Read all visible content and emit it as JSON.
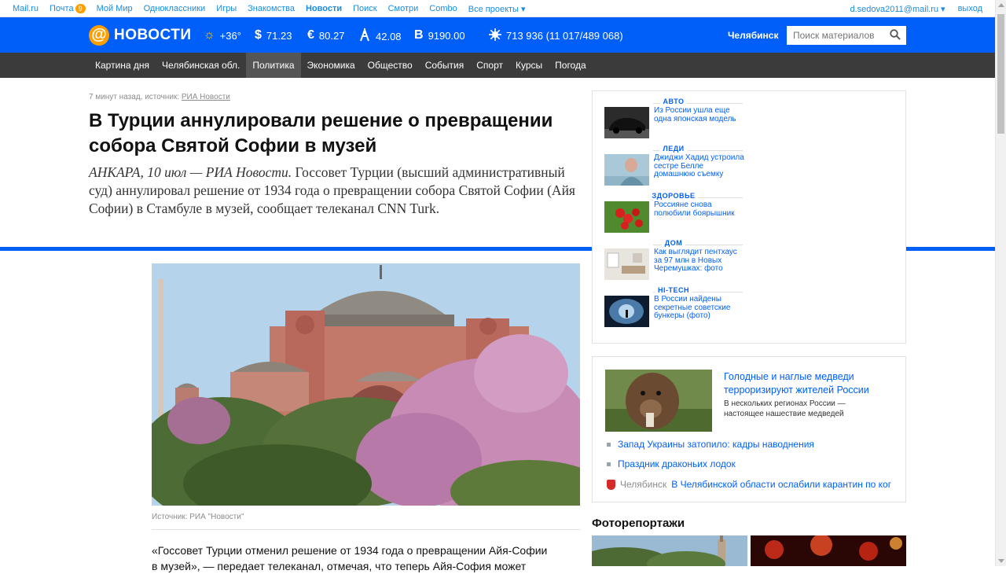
{
  "portal": {
    "links": [
      "Mail.ru",
      "Почта",
      "Мой Мир",
      "Одноклассники",
      "Игры",
      "Знакомства",
      "Новости",
      "Поиск",
      "Смотри",
      "Combo",
      "Все проекты"
    ],
    "mail_count": "9",
    "account": "d.sedova2011@mail.ru",
    "logout": "выход"
  },
  "header": {
    "logo_text": "НОВОСТИ",
    "weather": "+36°",
    "usd": "71.23",
    "eur": "80.27",
    "oil": "42.08",
    "btc": "9190.00",
    "virus": "713 936 (11 017/489 068)",
    "city": "Челябинск",
    "search_placeholder": "Поиск материалов"
  },
  "nav": {
    "items": [
      "Картина дня",
      "Челябинская обл.",
      "Политика",
      "Экономика",
      "Общество",
      "События",
      "Спорт",
      "Курсы",
      "Погода"
    ],
    "active_index": 2
  },
  "article": {
    "meta_prefix": "7 минут назад, источник: ",
    "meta_source": "РИА Новости",
    "title": "В Турции аннулировали решение о превращении собора Святой Софии в музей",
    "lead_italic": "АНКАРА, 10 июл — РИА Новости.",
    "lead_text": " Госсовет Турции (высший административный суд) аннулировал решение от 1934 года о превращении собора Святой Софии (Айя Софии) в Стамбуле в музей, сообщает телеканал CNN Turk.",
    "photo_caption": "Источник: РИА \"Новости\"",
    "body_line1": "«Госсовет Турции отменил решение от 1934 года о превращении Айя-Софии",
    "body_line2": "в музей», — передает телеканал, отмечая, что теперь Айя-София может"
  },
  "rail1": {
    "items": [
      {
        "category": "АВТО",
        "text": "Из России ушла еще одна японская модель"
      },
      {
        "category": "ЛЕДИ",
        "text": "Джиджи Хадид устроила сестре Белле домашнюю съемку"
      },
      {
        "category": "ЗДОРОВЬЕ",
        "text": "Россияне снова полюбили боярышник"
      },
      {
        "category": "ДОМ",
        "text": "Как выглядит пентхаус за 97 млн в Новых Черемушках: фото"
      },
      {
        "category": "HI-TECH",
        "text": "В России найдены секретные советские бункеры (фото)"
      }
    ]
  },
  "rail2": {
    "title": "Голодные и наглые медведи терроризируют жителей России",
    "subtitle": "В нескольких регионах России — настоящее нашествие медведей",
    "links": [
      "Запад Украины затопило: кадры наводнения",
      "Праздник драконьих лодок"
    ],
    "city_name": "Челябинск",
    "city_text": "В Челябинской области ослабили карантин по ког"
  },
  "photoreports": {
    "heading": "Фоторепортажи"
  },
  "colors": {
    "brand_blue": "#005ff9",
    "nav_dark": "#3b3b3b",
    "accent_orange": "#ff9e00"
  }
}
